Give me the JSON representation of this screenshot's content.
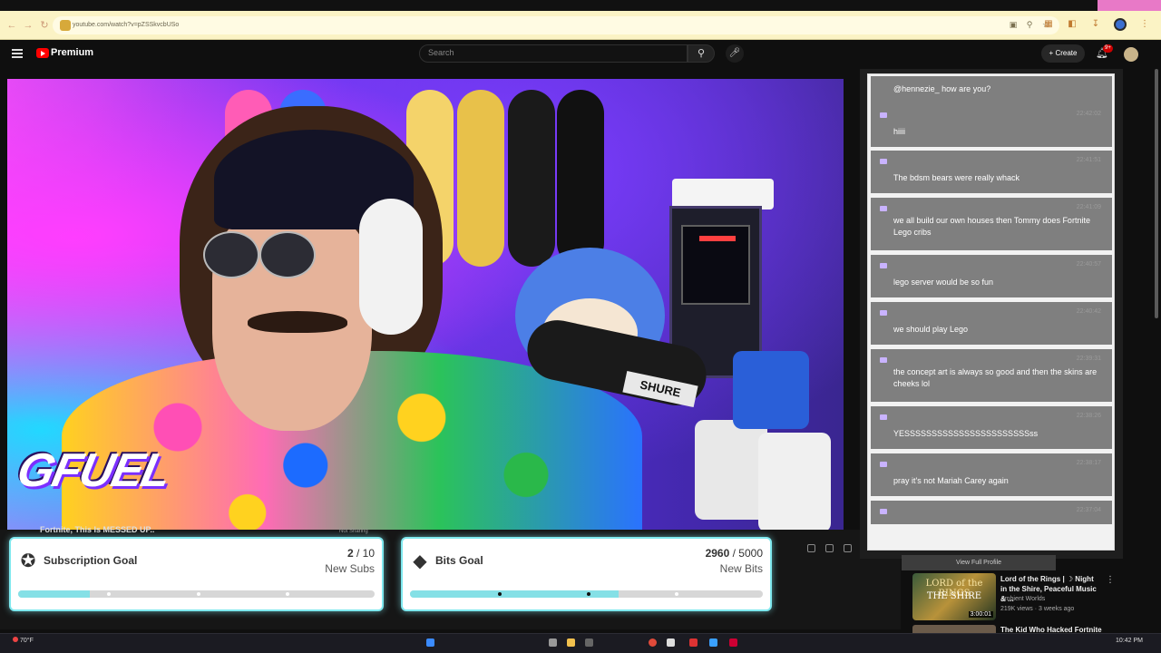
{
  "browser": {
    "url": "youtube.com/watch?v=pZSSkvcbUSo"
  },
  "youtube": {
    "brand": "Premium",
    "search_placeholder": "Search",
    "create_label": "Create",
    "notifications_badge": "9+"
  },
  "video": {
    "title": "Fortnite, This Is MESSED UP..",
    "sharing_status": "Not Sharing",
    "overlay_logo": "GFUEL",
    "mic_brand": "SHURE"
  },
  "goals": [
    {
      "name": "Subscription Goal",
      "current": "2",
      "target": "10",
      "unit": "New Subs",
      "progress": 0.2,
      "icon": "star-badge-icon"
    },
    {
      "name": "Bits Goal",
      "current": "2960",
      "target": "5000",
      "unit": "New Bits",
      "progress": 0.592,
      "icon": "bits-gem-icon"
    }
  ],
  "chat": {
    "messages": [
      {
        "text": "@hennezie_ how are you?"
      },
      {
        "time": "22:42:02",
        "text": "hiiii"
      },
      {
        "time": "22:41:51",
        "text": "The bdsm bears were really whack"
      },
      {
        "time": "22:41:09",
        "text": "we all build our own houses then Tommy does Fortnite Lego cribs"
      },
      {
        "time": "22:40:57",
        "text": "lego server would be so fun"
      },
      {
        "time": "22:40:42",
        "text": "we should play Lego"
      },
      {
        "time": "22:39:31",
        "text": "the concept art is always so good and then the skins are cheeks lol"
      },
      {
        "time": "22:38:26",
        "text": "YESSSSSSSSSSSSSSSSSSSSSSSss"
      },
      {
        "time": "22:38:17",
        "text": "pray it's not Mariah Carey again"
      },
      {
        "time": "22:37:04",
        "text": ""
      }
    ]
  },
  "sidebar": {
    "view_profile": "View Full Profile",
    "recommendations": [
      {
        "thumb_line1": "LORD of the RINGS",
        "thumb_line2": "THE SHIRE",
        "duration": "3:00:01",
        "title": "Lord of the Rings | ☽ Night in the Shire, Peaceful Music & ...",
        "channel": "Ambient Worlds",
        "meta": "219K views · 3 weeks ago"
      },
      {
        "title": "The Kid Who Hacked Fortnite"
      }
    ]
  },
  "taskbar": {
    "weather": "70°F",
    "clock": "10:42 PM"
  },
  "colors": {
    "goal_border": "#7ee8ee",
    "goal_fill": "#85e0e6",
    "chat_bubble": "#7f7f7f",
    "yt_red": "#ff0000"
  }
}
